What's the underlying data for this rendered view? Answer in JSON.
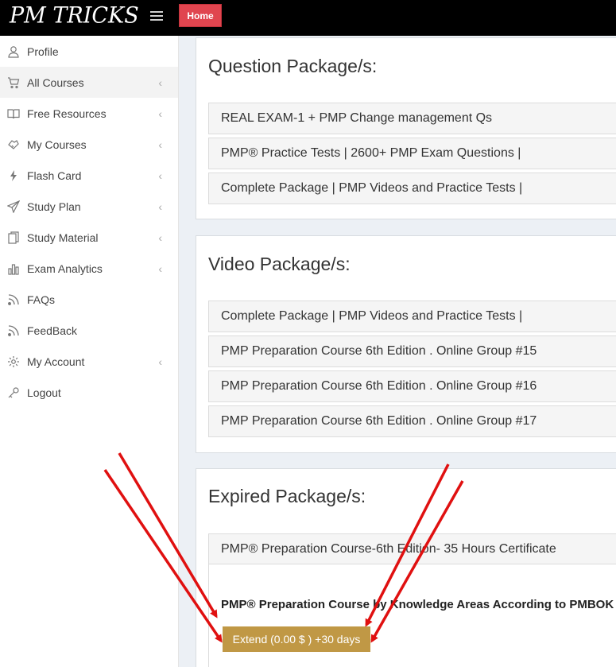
{
  "header": {
    "logo": "PM TRICKS",
    "home_button": "Home"
  },
  "sidebar": {
    "items": [
      {
        "label": "Profile",
        "icon": "user-icon",
        "chevron": false
      },
      {
        "label": "All Courses",
        "icon": "cart-icon",
        "chevron": true,
        "active": true
      },
      {
        "label": "Free Resources",
        "icon": "book-icon",
        "chevron": true
      },
      {
        "label": "My Courses",
        "icon": "handshake-icon",
        "chevron": true
      },
      {
        "label": "Flash Card",
        "icon": "bolt-icon",
        "chevron": true
      },
      {
        "label": "Study Plan",
        "icon": "paper-plane-icon",
        "chevron": true
      },
      {
        "label": "Study Material",
        "icon": "copy-icon",
        "chevron": true
      },
      {
        "label": "Exam Analytics",
        "icon": "bar-chart-icon",
        "chevron": true
      },
      {
        "label": "FAQs",
        "icon": "rss-icon",
        "chevron": false
      },
      {
        "label": "FeedBack",
        "icon": "rss-icon",
        "chevron": false
      },
      {
        "label": "My Account",
        "icon": "gear-icon",
        "chevron": true
      },
      {
        "label": "Logout",
        "icon": "key-icon",
        "chevron": false
      }
    ],
    "chevron_glyph": "‹"
  },
  "main": {
    "question_packages": {
      "title": "Question Package/s:",
      "items": [
        "REAL EXAM-1 + PMP Change management Qs",
        "PMP® Practice Tests | 2600+ PMP Exam Questions |",
        "Complete Package | PMP Videos and Practice Tests |"
      ]
    },
    "video_packages": {
      "title": "Video Package/s:",
      "items": [
        "Complete Package | PMP Videos and Practice Tests |",
        "PMP Preparation Course 6th Edition . Online Group #15",
        "PMP Preparation Course 6th Edition . Online Group #16",
        "PMP Preparation Course 6th Edition . Online Group #17"
      ]
    },
    "expired_packages": {
      "title": "Expired Package/s:",
      "item": "PMP® Preparation Course-6th Edition- 35 Hours Certificate",
      "course_name": "PMP® Preparation Course by Knowledge Areas According to PMBOK",
      "extend_button": "Extend (0.00 $ ) +30 days"
    }
  },
  "colors": {
    "home_button": "#e0454f",
    "extend_button": "#c09845",
    "annotation_arrow": "#e01010"
  }
}
